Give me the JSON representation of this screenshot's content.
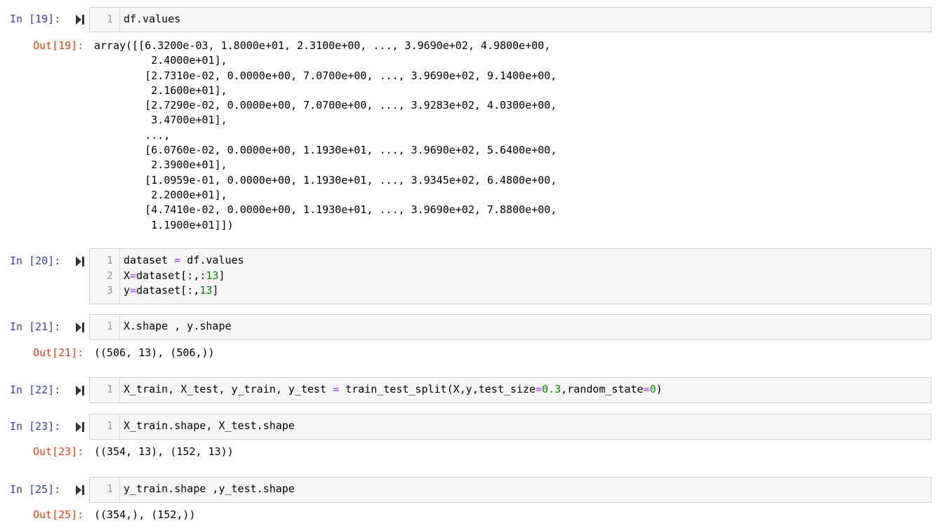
{
  "cells": [
    {
      "in_prompt": "In [19]:",
      "lines": [
        {
          "no": "1",
          "tokens": [
            {
              "t": "df.values",
              "c": ""
            }
          ]
        }
      ],
      "out_prompt": "Out[19]:",
      "output": "array([[6.3200e-03, 1.8000e+01, 2.3100e+00, ..., 3.9690e+02, 4.9800e+00,\n         2.4000e+01],\n        [2.7310e-02, 0.0000e+00, 7.0700e+00, ..., 3.9690e+02, 9.1400e+00,\n         2.1600e+01],\n        [2.7290e-02, 0.0000e+00, 7.0700e+00, ..., 3.9283e+02, 4.0300e+00,\n         3.4700e+01],\n        ...,\n        [6.0760e-02, 0.0000e+00, 1.1930e+01, ..., 3.9690e+02, 5.6400e+00,\n         2.3900e+01],\n        [1.0959e-01, 0.0000e+00, 1.1930e+01, ..., 3.9345e+02, 6.4800e+00,\n         2.2000e+01],\n        [4.7410e-02, 0.0000e+00, 1.1930e+01, ..., 3.9690e+02, 7.8800e+00,\n         1.1900e+01]])"
    },
    {
      "in_prompt": "In [20]:",
      "lines": [
        {
          "no": "1",
          "tokens": [
            {
              "t": "dataset ",
              "c": ""
            },
            {
              "t": "=",
              "c": "op"
            },
            {
              "t": " df.values",
              "c": ""
            }
          ]
        },
        {
          "no": "2",
          "tokens": [
            {
              "t": "X",
              "c": ""
            },
            {
              "t": "=",
              "c": "op"
            },
            {
              "t": "dataset[:,:",
              "c": ""
            },
            {
              "t": "13",
              "c": "num"
            },
            {
              "t": "]",
              "c": ""
            }
          ]
        },
        {
          "no": "3",
          "tokens": [
            {
              "t": "y",
              "c": ""
            },
            {
              "t": "=",
              "c": "op"
            },
            {
              "t": "dataset[:,",
              "c": ""
            },
            {
              "t": "13",
              "c": "num"
            },
            {
              "t": "]",
              "c": ""
            }
          ]
        }
      ],
      "out_prompt": "",
      "output": ""
    },
    {
      "in_prompt": "In [21]:",
      "lines": [
        {
          "no": "1",
          "tokens": [
            {
              "t": "X.shape , y.shape",
              "c": ""
            }
          ]
        }
      ],
      "out_prompt": "Out[21]:",
      "output": "((506, 13), (506,))"
    },
    {
      "in_prompt": "In [22]:",
      "lines": [
        {
          "no": "1",
          "tokens": [
            {
              "t": "X_train, X_test, y_train, y_test ",
              "c": ""
            },
            {
              "t": "=",
              "c": "op"
            },
            {
              "t": " train_test_split(X,y,test_size",
              "c": ""
            },
            {
              "t": "=",
              "c": "op"
            },
            {
              "t": "0.3",
              "c": "num"
            },
            {
              "t": ",random_state",
              "c": ""
            },
            {
              "t": "=",
              "c": "op"
            },
            {
              "t": "0",
              "c": "num"
            },
            {
              "t": ")",
              "c": ""
            }
          ]
        }
      ],
      "out_prompt": "",
      "output": ""
    },
    {
      "in_prompt": "In [23]:",
      "lines": [
        {
          "no": "1",
          "tokens": [
            {
              "t": "X_train.shape, X_test.shape",
              "c": ""
            }
          ]
        }
      ],
      "out_prompt": "Out[23]:",
      "output": "((354, 13), (152, 13))"
    },
    {
      "in_prompt": "In [25]:",
      "lines": [
        {
          "no": "1",
          "tokens": [
            {
              "t": "y_train.shape ,y_test.shape",
              "c": ""
            }
          ]
        }
      ],
      "out_prompt": "Out[25]:",
      "output": "((354,), (152,))"
    }
  ],
  "icons": {
    "run": "run-cell-icon"
  },
  "colors": {
    "in_prompt": "#303f9f",
    "out_prompt": "#d84315",
    "operator": "#aa22ff",
    "number": "#008800",
    "cell_bg": "#f7f7f7",
    "cell_border": "#cfcfcf"
  }
}
